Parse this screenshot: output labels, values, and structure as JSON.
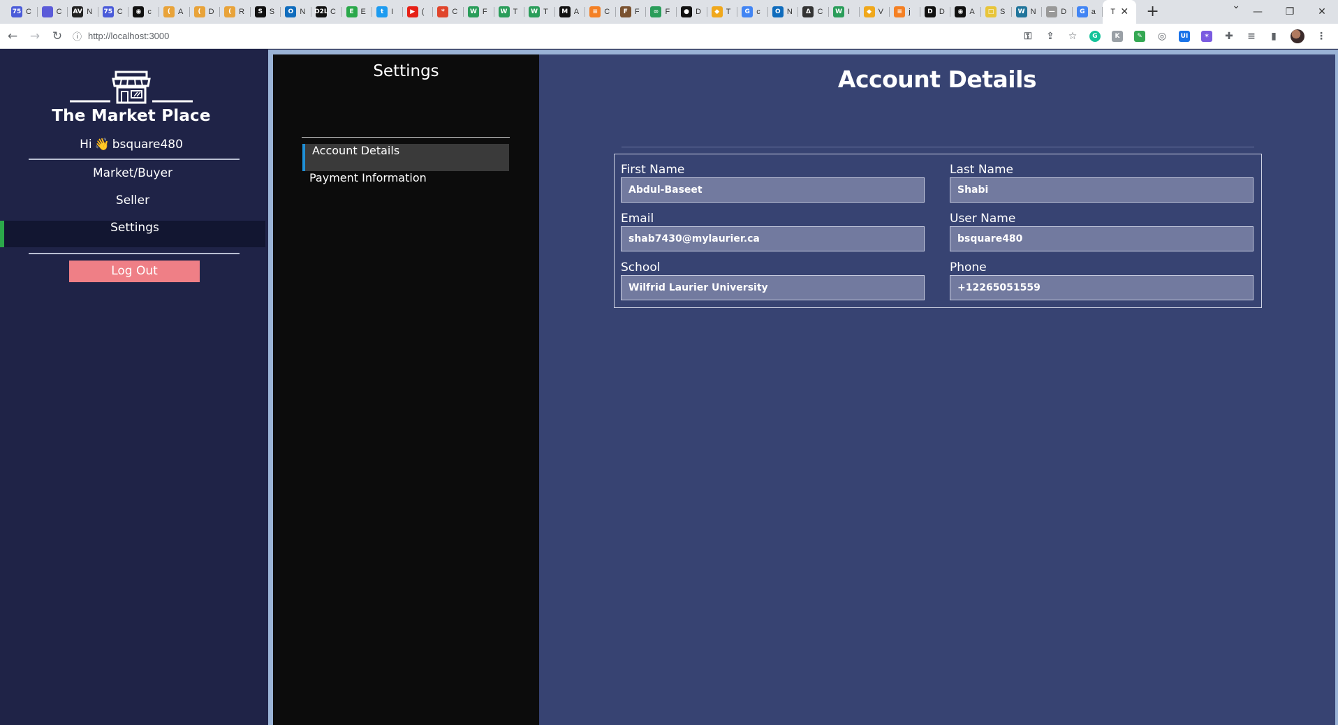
{
  "browser": {
    "tabs": [
      {
        "icon": "tab-favicon-icon",
        "color": "#4a5bd9",
        "glyph": "75",
        "title": "C"
      },
      {
        "icon": "tab-favicon-icon",
        "color": "#5b5bd9",
        "glyph": "",
        "title": "C"
      },
      {
        "icon": "tab-favicon-icon",
        "color": "#222222",
        "glyph": "AV",
        "title": "N"
      },
      {
        "icon": "tab-favicon-icon",
        "color": "#4a5bd9",
        "glyph": "75",
        "title": "C"
      },
      {
        "icon": "github-icon",
        "color": "#111111",
        "glyph": "◉",
        "title": "c"
      },
      {
        "icon": "tab-favicon-icon",
        "color": "#e8a33a",
        "glyph": "(",
        "title": "A"
      },
      {
        "icon": "tab-favicon-icon",
        "color": "#e8a33a",
        "glyph": "(",
        "title": "D"
      },
      {
        "icon": "tab-favicon-icon",
        "color": "#e8a33a",
        "glyph": "(",
        "title": "R"
      },
      {
        "icon": "tab-favicon-icon",
        "color": "#111111",
        "glyph": "S",
        "title": "S"
      },
      {
        "icon": "outlook-icon",
        "color": "#0f6cbd",
        "glyph": "O",
        "title": "N"
      },
      {
        "icon": "tab-favicon-icon",
        "color": "#111111",
        "glyph": "D2L",
        "title": "C"
      },
      {
        "icon": "tab-favicon-icon",
        "color": "#2aa84a",
        "glyph": "E",
        "title": "E"
      },
      {
        "icon": "twitter-icon",
        "color": "#1d9bf0",
        "glyph": "t",
        "title": "I"
      },
      {
        "icon": "youtube-icon",
        "color": "#e62117",
        "glyph": "▶",
        "title": "("
      },
      {
        "icon": "tab-favicon-icon",
        "color": "#e0452c",
        "glyph": "*",
        "title": "C"
      },
      {
        "icon": "tab-favicon-icon",
        "color": "#2a9d5a",
        "glyph": "W",
        "title": "F"
      },
      {
        "icon": "tab-favicon-icon",
        "color": "#2a9d5a",
        "glyph": "W",
        "title": "T"
      },
      {
        "icon": "tab-favicon-icon",
        "color": "#2a9d5a",
        "glyph": "W",
        "title": "T"
      },
      {
        "icon": "tab-favicon-icon",
        "color": "#111111",
        "glyph": "M",
        "title": "A"
      },
      {
        "icon": "tab-favicon-icon",
        "color": "#f48024",
        "glyph": "≡",
        "title": "C"
      },
      {
        "icon": "tab-favicon-icon",
        "color": "#7a5230",
        "glyph": "F",
        "title": "F"
      },
      {
        "icon": "tab-favicon-icon",
        "color": "#2a9d5a",
        "glyph": "∞",
        "title": "F"
      },
      {
        "icon": "tab-favicon-icon",
        "color": "#111111",
        "glyph": "●",
        "title": "D"
      },
      {
        "icon": "tab-favicon-icon",
        "color": "#f0a81c",
        "glyph": "◆",
        "title": "T"
      },
      {
        "icon": "google-icon",
        "color": "#4285f4",
        "glyph": "G",
        "title": "c"
      },
      {
        "icon": "outlook-icon",
        "color": "#0f6cbd",
        "glyph": "O",
        "title": "N"
      },
      {
        "icon": "tab-favicon-icon",
        "color": "#333333",
        "glyph": "Δ",
        "title": "C"
      },
      {
        "icon": "tab-favicon-icon",
        "color": "#2a9d5a",
        "glyph": "W",
        "title": "I"
      },
      {
        "icon": "tab-favicon-icon",
        "color": "#f0a81c",
        "glyph": "◆",
        "title": "V"
      },
      {
        "icon": "tab-favicon-icon",
        "color": "#f48024",
        "glyph": "≡",
        "title": "j"
      },
      {
        "icon": "tab-favicon-icon",
        "color": "#111111",
        "glyph": "D",
        "title": "D"
      },
      {
        "icon": "github-icon",
        "color": "#111111",
        "glyph": "◉",
        "title": "A"
      },
      {
        "icon": "tab-favicon-icon",
        "color": "#e8c53a",
        "glyph": "□",
        "title": "S"
      },
      {
        "icon": "wordpress-icon",
        "color": "#21759b",
        "glyph": "W",
        "title": "N"
      },
      {
        "icon": "tab-favicon-icon",
        "color": "#999999",
        "glyph": "—",
        "title": "D"
      },
      {
        "icon": "google-icon",
        "color": "#4285f4",
        "glyph": "G",
        "title": "a"
      }
    ],
    "active_tab": {
      "title": "T",
      "close": "✕"
    },
    "new_tab": "+",
    "url": "http://localhost:3000",
    "window_controls": {
      "minimize": "—",
      "restore": "❐",
      "close": "✕",
      "tab_search": "⌄"
    }
  },
  "sidebar": {
    "brand": "The Market Place",
    "greeting_prefix": "Hi",
    "greeting_emoji": "👋",
    "username": "bsquare480",
    "nav": [
      {
        "label": "Market/Buyer",
        "active": false
      },
      {
        "label": "Seller",
        "active": false
      },
      {
        "label": "Settings",
        "active": true
      }
    ],
    "logout_label": "Log Out"
  },
  "settings": {
    "title": "Settings",
    "items": [
      {
        "label": "Account Details",
        "active": true
      },
      {
        "label": "Payment Information",
        "active": false
      }
    ]
  },
  "account": {
    "title": "Account Details",
    "fields": {
      "first_name": {
        "label": "First Name",
        "value": "Abdul-Baseet"
      },
      "last_name": {
        "label": "Last Name",
        "value": "Shabi"
      },
      "email": {
        "label": "Email",
        "value": "shab7430@mylaurier.ca"
      },
      "user_name": {
        "label": "User Name",
        "value": "bsquare480"
      },
      "school": {
        "label": "School",
        "value": "Wilfrid Laurier University"
      },
      "phone": {
        "label": "Phone",
        "value": "+12265051559"
      }
    }
  },
  "colors": {
    "sidebar_bg": "#1f2347",
    "settings_bg": "#0c0c0c",
    "main_bg": "#374372",
    "logout_bg": "#ef7f86",
    "active_nav_accent": "#2ba84a",
    "active_setting_accent": "#1f8fd6"
  }
}
